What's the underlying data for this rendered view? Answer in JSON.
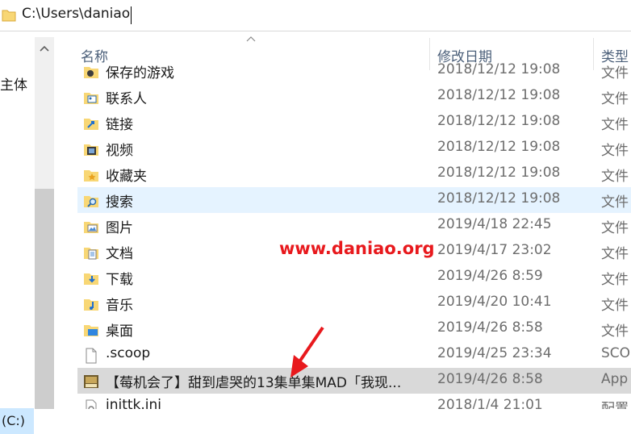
{
  "address": {
    "path": "C:\\Users\\daniao"
  },
  "nav": {
    "label_partial": "主体",
    "drive_label": "(C:)"
  },
  "header": {
    "name": "名称",
    "date": "修改日期",
    "type": "类型"
  },
  "files": [
    {
      "name": "保存的游戏",
      "date": "2018/12/12 19:08",
      "type": "文件",
      "icon": "saved-games-folder-icon"
    },
    {
      "name": "联系人",
      "date": "2018/12/12 19:08",
      "type": "文件",
      "icon": "contacts-folder-icon"
    },
    {
      "name": "链接",
      "date": "2018/12/12 19:08",
      "type": "文件",
      "icon": "links-folder-icon"
    },
    {
      "name": "视频",
      "date": "2018/12/12 19:08",
      "type": "文件",
      "icon": "videos-folder-icon"
    },
    {
      "name": "收藏夹",
      "date": "2018/12/12 19:08",
      "type": "文件",
      "icon": "favorites-folder-icon"
    },
    {
      "name": "搜索",
      "date": "2018/12/12 19:08",
      "type": "文件",
      "icon": "searches-folder-icon"
    },
    {
      "name": "图片",
      "date": "2019/4/18 22:45",
      "type": "文件",
      "icon": "pictures-folder-icon"
    },
    {
      "name": "文档",
      "date": "2019/4/17 23:02",
      "type": "文件",
      "icon": "documents-folder-icon"
    },
    {
      "name": "下载",
      "date": "2019/4/26 8:59",
      "type": "文件",
      "icon": "downloads-folder-icon"
    },
    {
      "name": "音乐",
      "date": "2019/4/20 10:41",
      "type": "文件",
      "icon": "music-folder-icon"
    },
    {
      "name": "桌面",
      "date": "2019/4/26 8:58",
      "type": "文件",
      "icon": "desktop-folder-icon"
    },
    {
      "name": ".scoop",
      "date": "2019/4/25 23:34",
      "type": "SCO",
      "icon": "file-icon"
    },
    {
      "name": "【莓机会了】甜到虐哭的13集单集MAD「我现...",
      "date": "2019/4/26 8:58",
      "type": "App",
      "icon": "video-file-icon"
    },
    {
      "name": "inittk.ini",
      "date": "2018/1/4 21:01",
      "type": "配置",
      "icon": "ini-file-icon"
    }
  ],
  "watermark": "www.daniao.org",
  "colors": {
    "hover": "#e5f3ff",
    "selected": "#d9d9d9",
    "folder": "#f8d775",
    "watermark": "#e8191d"
  }
}
